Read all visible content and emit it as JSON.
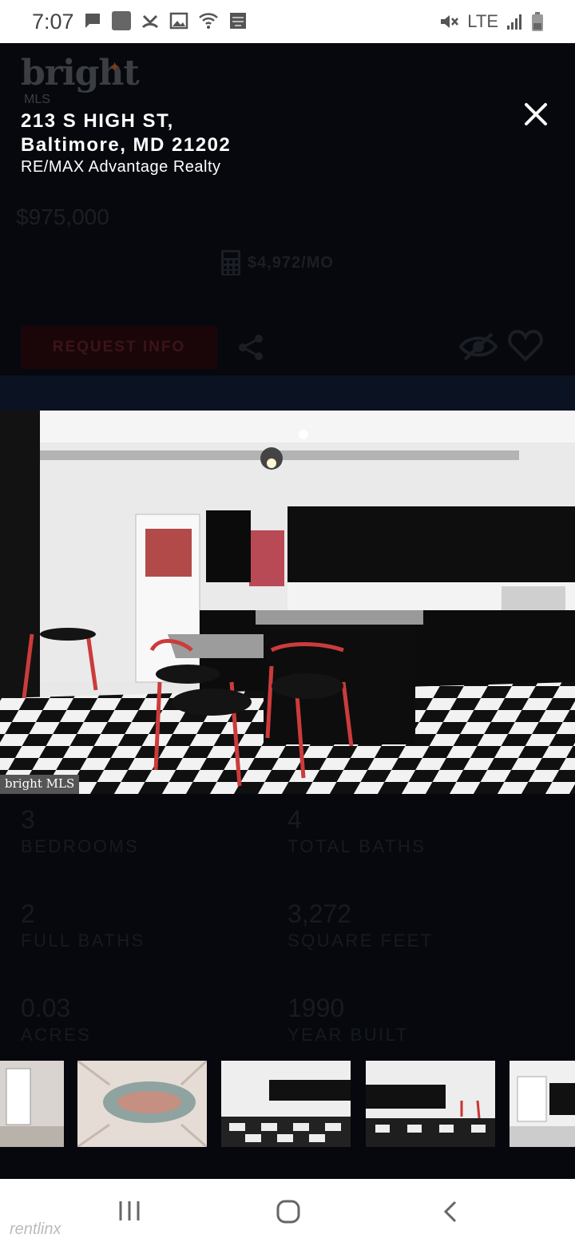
{
  "status_bar": {
    "time": "7:07",
    "network": "LTE",
    "icons": [
      "message-icon",
      "notification-icon",
      "missed-call-icon",
      "gallery-icon",
      "wifi-icon",
      "app-icon",
      "mute-icon",
      "signal-icon",
      "battery-icon"
    ]
  },
  "logo": {
    "word": "bright",
    "sub": "MLS"
  },
  "listing": {
    "address_line1": "213 S HIGH ST,",
    "address_line2": "Baltimore, MD 21202",
    "broker": "RE/MAX Advantage Realty",
    "price": "$975,000",
    "monthly": "$4,972/MO"
  },
  "actions": {
    "request_info": "REQUEST INFO"
  },
  "photo": {
    "watermark": "bright MLS"
  },
  "stats": [
    {
      "value": "3",
      "label": "BEDROOMS"
    },
    {
      "value": "4",
      "label": "TOTAL BATHS"
    },
    {
      "value": "2",
      "label": "FULL BATHS"
    },
    {
      "value": "3,272",
      "label": "SQUARE FEET"
    },
    {
      "value": "0.03",
      "label": "ACRES"
    },
    {
      "value": "1990",
      "label": "YEAR BUILT"
    }
  ],
  "footer_brand": "rentlinx",
  "colors": {
    "screen_bg": "#06080d",
    "accent_band": "#0b1322",
    "button_bg": "#1a0609"
  }
}
